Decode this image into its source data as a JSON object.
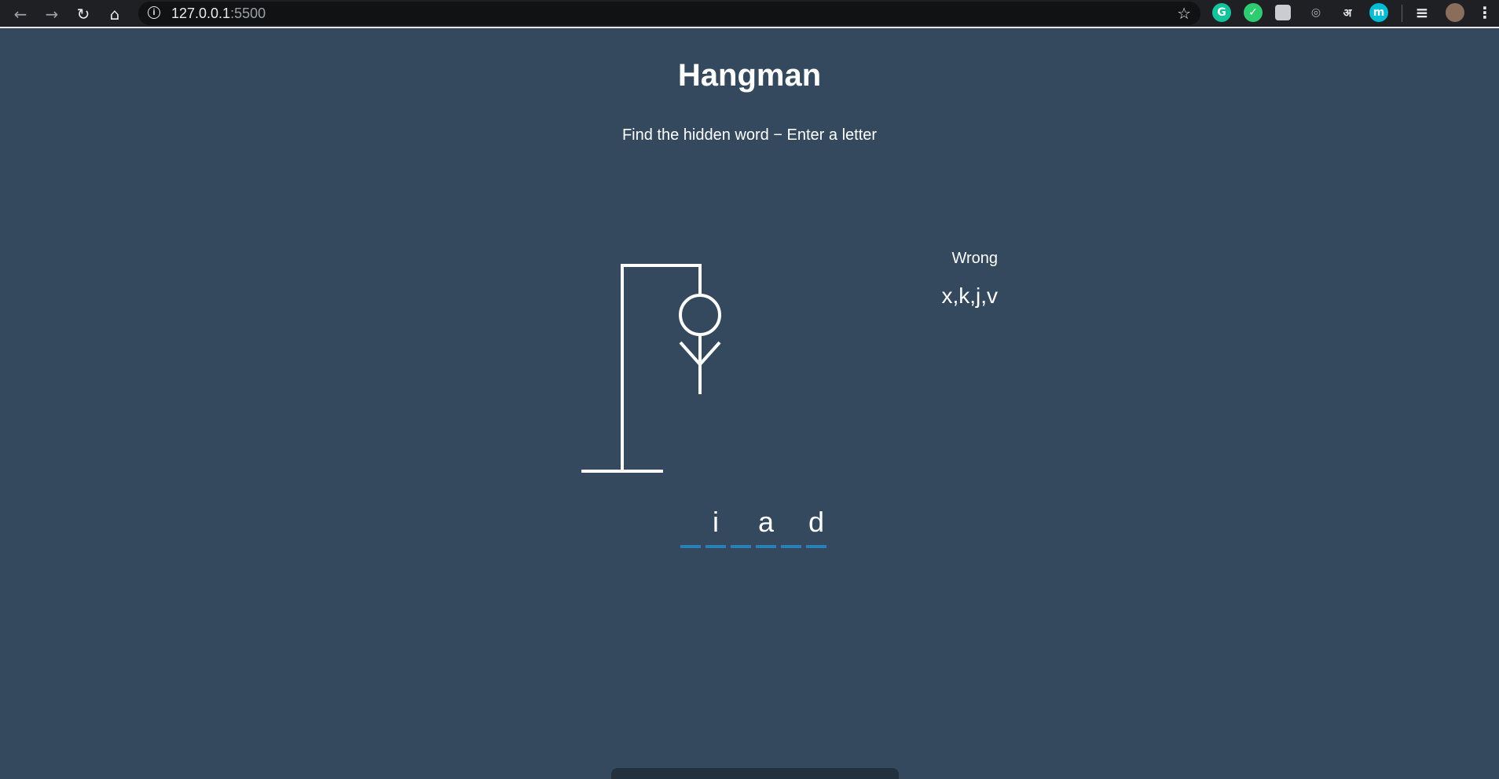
{
  "browser": {
    "back_glyph": "←",
    "forward_glyph": "→",
    "reload_glyph": "↻",
    "home_glyph": "⌂",
    "info_glyph": "i",
    "url_host": "127.0.0.1",
    "url_port": ":5500",
    "bookmark_glyph": "☆",
    "extensions": [
      {
        "name": "grammarly-icon",
        "glyph": "G",
        "color": "#15c39a"
      },
      {
        "name": "shield-check-icon",
        "glyph": "✓",
        "color": "#2ecc71"
      },
      {
        "name": "extension-box-icon",
        "glyph": "",
        "color": "#c9ccd1"
      },
      {
        "name": "circle-extension-icon",
        "glyph": "◎",
        "color": "#b0b3b8"
      },
      {
        "name": "hindi-input-icon",
        "glyph": "अ",
        "color": "#e8eaed"
      },
      {
        "name": "m-extension-icon",
        "glyph": "m",
        "color": "#00bcd4"
      }
    ],
    "media_glyph": "≡",
    "menu_glyph": "⋮"
  },
  "page": {
    "title": "Hangman",
    "subtitle": "Find the hidden word − Enter a letter",
    "background": "#34495e",
    "accent": "#2980b9"
  },
  "wrong": {
    "label": "Wrong",
    "letters": "x,k,j,v"
  },
  "word": {
    "slots": [
      "",
      "i",
      "",
      "a",
      "",
      "d"
    ]
  }
}
